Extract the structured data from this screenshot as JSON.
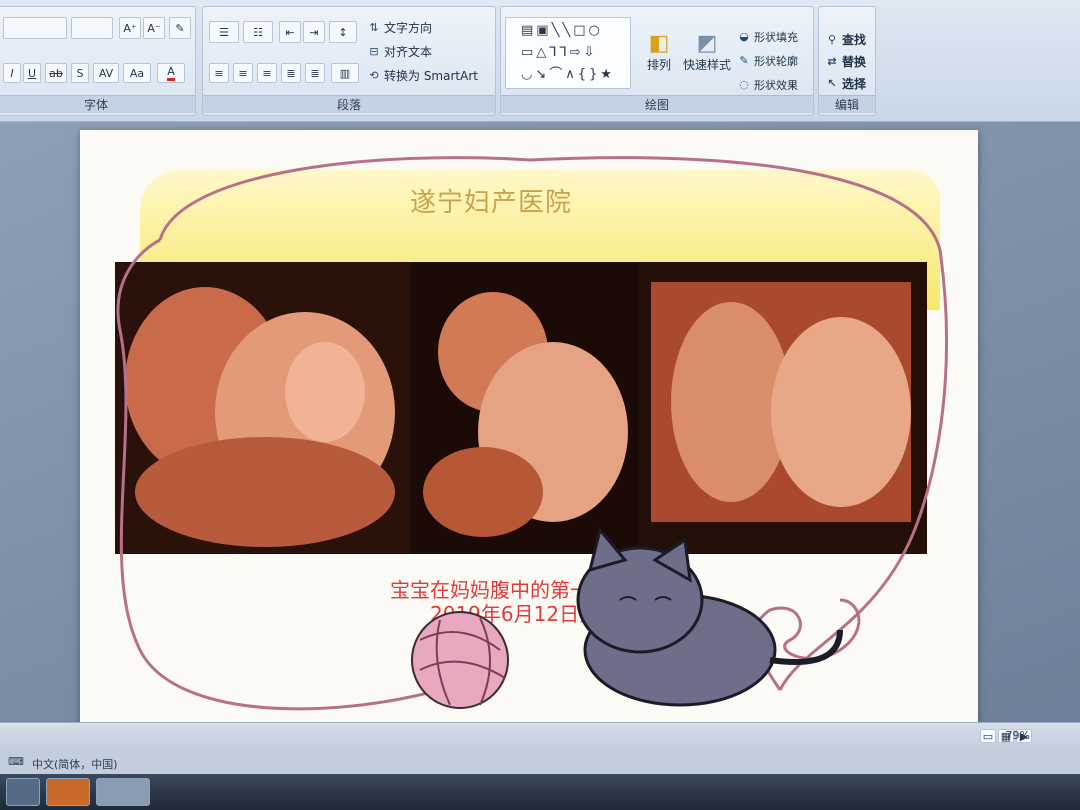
{
  "ribbon": {
    "groups": {
      "font": {
        "label": "字体"
      },
      "paragraph": {
        "label": "段落"
      },
      "drawing": {
        "label": "绘图"
      },
      "editing": {
        "label": "编辑"
      }
    },
    "paragraph": {
      "text_direction": "文字方向",
      "align_text": "对齐文本",
      "convert_smartart": "转换为 SmartArt"
    },
    "drawing": {
      "arrange": "排列",
      "quick_styles": "快速样式",
      "shape_fill": "形状填充",
      "shape_outline": "形状轮廓",
      "shape_effects": "形状效果"
    },
    "editing": {
      "find": "查找",
      "replace": "替换",
      "select": "选择"
    }
  },
  "slide": {
    "title": "遂宁妇产医院",
    "caption_line1": "宝宝在妈妈腹中的第一张照片",
    "caption_line2": "2019年6月12日星期三"
  },
  "statusbar": {
    "zoom": "79%"
  },
  "langbar": {
    "text": "中文(简体，中国)"
  },
  "colors": {
    "caption": "#e03a3a",
    "title": "#c9a24e",
    "banner": "#f6e86a"
  }
}
